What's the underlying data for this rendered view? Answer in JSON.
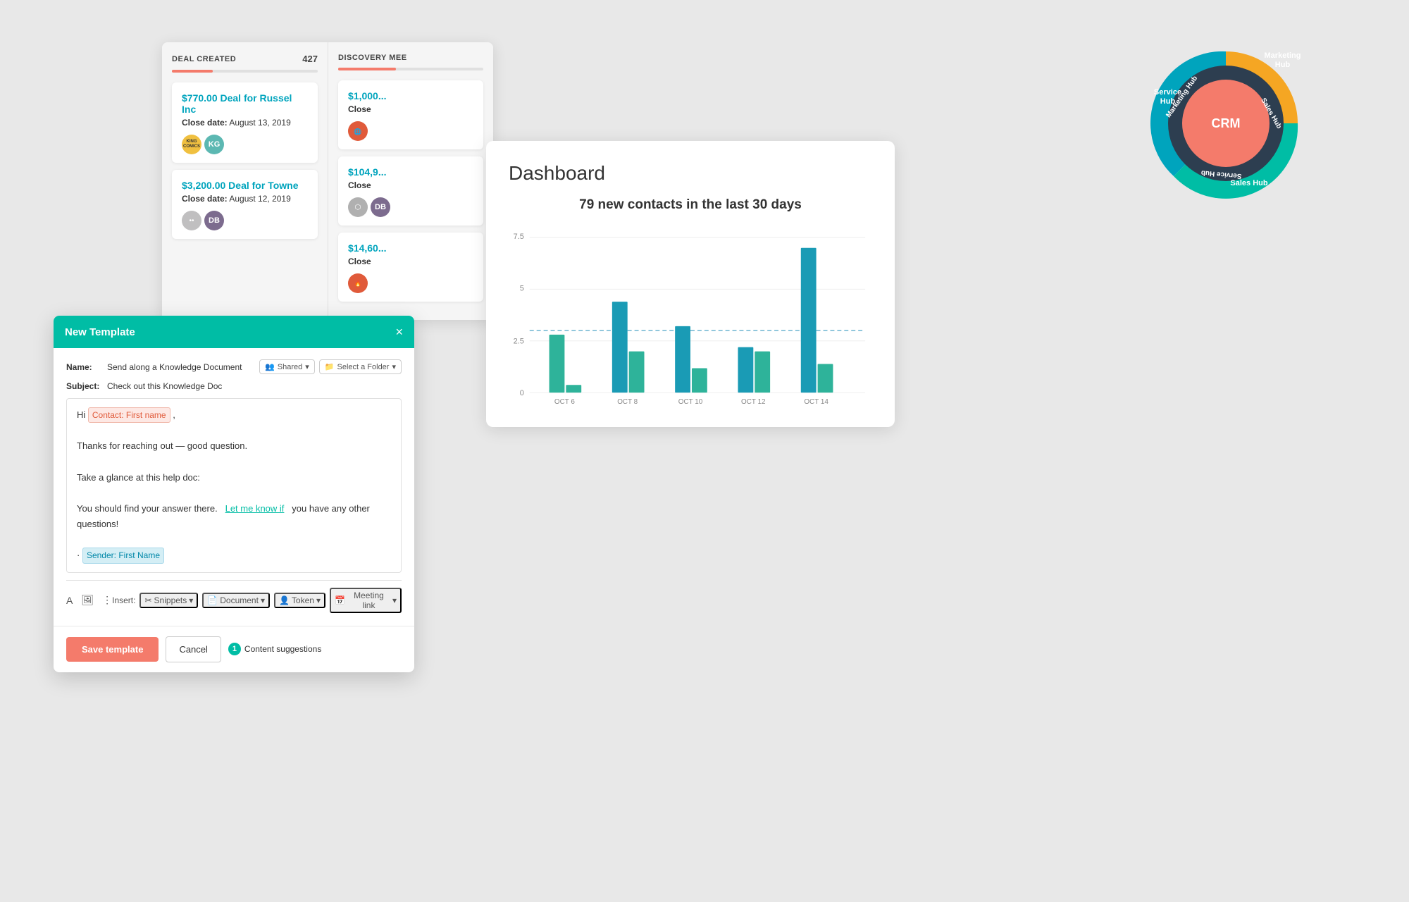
{
  "background": "#e8e8e8",
  "dealPanel": {
    "columns": [
      {
        "title": "DEAL CREATED",
        "count": "427",
        "progressWidth": "28%",
        "cards": [
          {
            "amount": "$770.00 Deal for Russel Inc",
            "dateLabel": "Close date:",
            "date": "August 13, 2019",
            "avatars": [
              {
                "type": "logo",
                "label": "COMICS"
              },
              {
                "type": "initials",
                "initials": "KG",
                "class": "avatar-kg"
              }
            ]
          },
          {
            "amount": "$3,200.00 Deal for Towne",
            "dateLabel": "Close date:",
            "date": "August 12, 2019",
            "avatars": [
              {
                "type": "multi",
                "label": ""
              },
              {
                "type": "initials",
                "initials": "DB",
                "class": "avatar-db"
              }
            ]
          }
        ]
      },
      {
        "title": "DISCOVERY MEE",
        "count": "",
        "progressWidth": "40%",
        "cards": [
          {
            "amount": "$1,000...",
            "dateLabel": "Close",
            "date": "",
            "partial": true
          },
          {
            "amount": "$104,9...",
            "dateLabel": "Close",
            "date": "",
            "partial": true
          },
          {
            "amount": "$14,60...",
            "dateLabel": "Close",
            "date": "",
            "partial": true
          }
        ]
      }
    ]
  },
  "templateModal": {
    "title": "New Template",
    "close": "×",
    "nameLabel": "Name:",
    "nameValue": "Send along a Knowledge Document",
    "sharedLabel": "Shared",
    "folderLabel": "Select a Folder",
    "subjectLabel": "Subject:",
    "subjectValue": "Check out this Knowledge Doc",
    "editorContent": {
      "line1_prefix": "Hi",
      "token1": "Contact: First name",
      "line2": "Thanks for reaching out — good question.",
      "line3": "Take a glance at this help doc:",
      "line4_prefix": "You should find your answer there.",
      "link_text": "Let me know if",
      "line4_suffix": "you have any other questions!",
      "token2": "Sender: First Name"
    },
    "toolbar": {
      "insertLabel": "Insert:",
      "snippets": "Snippets",
      "document": "Document",
      "token": "Token",
      "meetingLink": "Meeting link"
    },
    "footer": {
      "saveLabel": "Save template",
      "cancelLabel": "Cancel",
      "contentSuggestionsCount": "1",
      "contentSuggestionsLabel": "Content suggestions"
    }
  },
  "dashboard": {
    "title": "Dashboard",
    "subtitle": "79 new contacts in the last 30 days",
    "chart": {
      "yMax": 7.5,
      "yMid": 5,
      "yLine": 2.5,
      "yZero": 0,
      "avgLineY": 3.0,
      "labels": [
        "OCT 6",
        "OCT 8",
        "OCT 10",
        "OCT 12",
        "OCT 14"
      ],
      "bars": [
        {
          "label": "OCT 6",
          "v1": 2.8,
          "v2": 0.4,
          "color1": "#2eb39a",
          "color2": "#2eb39a"
        },
        {
          "label": "OCT 8",
          "v1": 4.4,
          "v2": 2.0,
          "color1": "#1a9bb5",
          "color2": "#2eb39a"
        },
        {
          "label": "OCT 10",
          "v1": 3.2,
          "v2": 1.2,
          "color1": "#1a9bb5",
          "color2": "#2eb39a"
        },
        {
          "label": "OCT 12",
          "v1": 2.2,
          "v2": 2.0,
          "color1": "#1a9bb5",
          "color2": "#2eb39a"
        },
        {
          "label": "OCT 14",
          "v1": 7.0,
          "v2": 1.4,
          "color1": "#1a9bb5",
          "color2": "#2eb39a"
        }
      ]
    }
  },
  "hubspotWheel": {
    "crm": "CRM",
    "segments": [
      {
        "label": "Marketing Hub",
        "color": "#f5a623"
      },
      {
        "label": "Sales Hub",
        "color": "#00bda5"
      },
      {
        "label": "Service Hub",
        "color": "#00a4bd"
      }
    ]
  }
}
